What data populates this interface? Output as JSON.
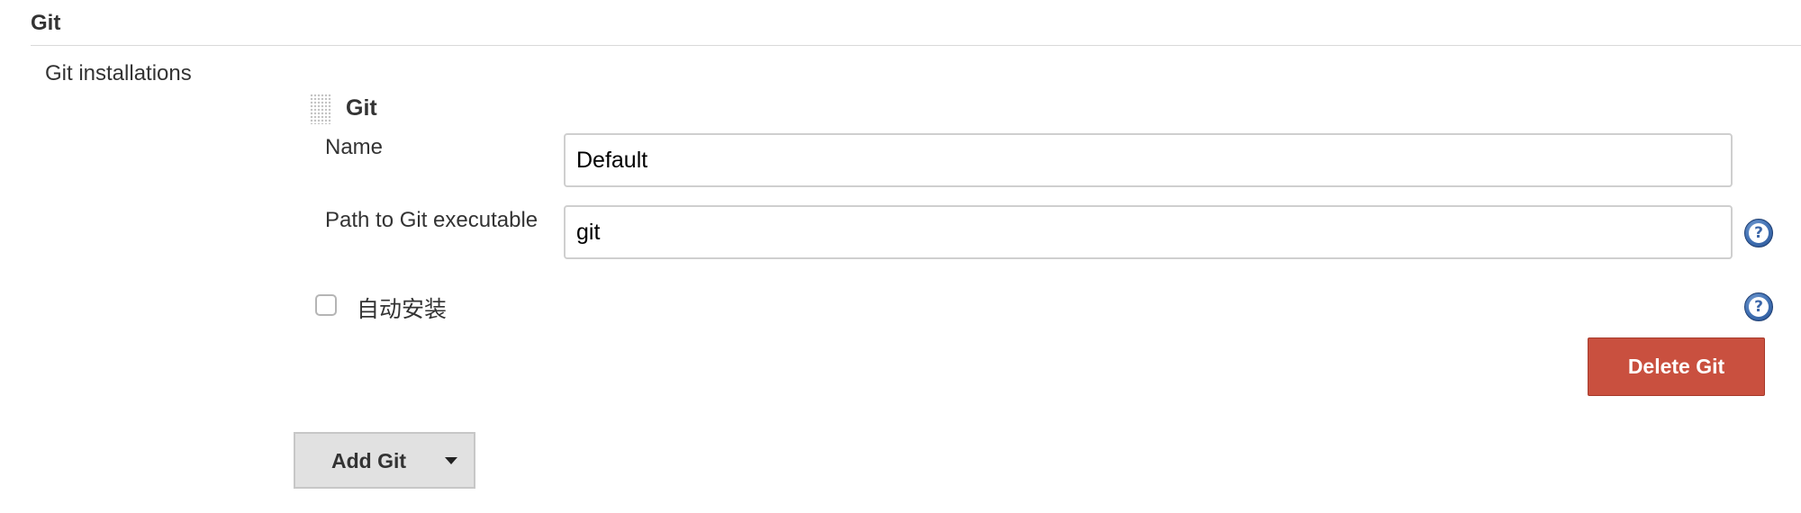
{
  "section": {
    "title": "Git"
  },
  "installations": {
    "label": "Git installations",
    "item": {
      "title": "Git",
      "name": {
        "label": "Name",
        "value": "Default"
      },
      "path": {
        "label": "Path to Git executable",
        "value": "git"
      },
      "auto_install": {
        "label": "自动安装",
        "checked": false
      },
      "delete_label": "Delete Git"
    },
    "add_label": "Add Git"
  },
  "icons": {
    "help": "help-icon",
    "drag": "drag-handle-icon",
    "dropdown": "caret-down-icon"
  },
  "colors": {
    "delete_button": "#c9503f",
    "help_icon": "#3f6fb2"
  }
}
